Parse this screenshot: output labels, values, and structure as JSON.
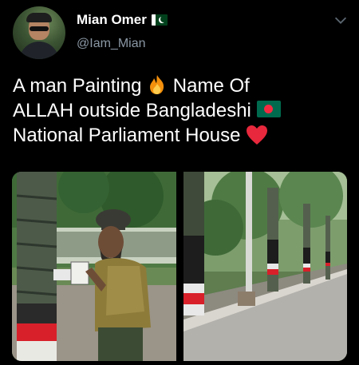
{
  "author": {
    "name": "Mian Omer",
    "handle": "@Iam_Mian",
    "flag_icon": "pakistan-flag"
  },
  "tweet": {
    "line1_text": "A man Painting",
    "line1_emoji": "fire",
    "line1_tail": "Name Of",
    "line2_text": "ALLAH outside Bangladeshi",
    "line2_emoji": "bangladesh-flag",
    "line3_text": "National Parliament House",
    "line3_emoji": "red-heart"
  },
  "media": {
    "photo_count": 2,
    "left_photo": "man holding paint cup beside palm tree painted black, white and red",
    "right_photo": "row of painted trees along a road"
  },
  "colors": {
    "background": "#000000",
    "text": "#ffffff",
    "handle": "#8b98a5",
    "heart": "#e8283c"
  }
}
